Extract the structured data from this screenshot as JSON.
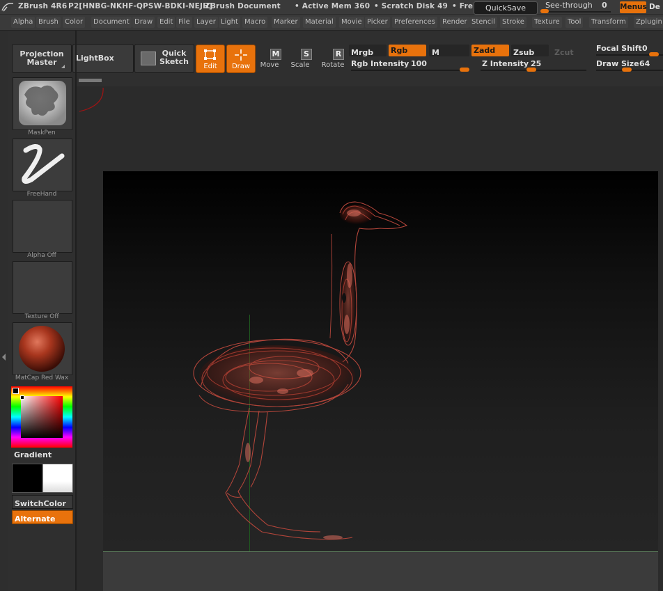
{
  "title_bar": {
    "app_name": "ZBrush 4R6",
    "serial": "P2[HNBG-NKHF-QPSW-BDKI-NEJH]",
    "document": "ZBrush Document",
    "active_mem": "• Active Mem 360",
    "scratch_disk": "• Scratch Disk 49",
    "free": "• Fre",
    "quicksave": "QuickSave",
    "see_through_label": "See-through",
    "see_through_value": "0",
    "see_through_level": 0,
    "menus": "Menus",
    "default_script": "De"
  },
  "menus": [
    "Alpha",
    "Brush",
    "Color",
    "Document",
    "Draw",
    "Edit",
    "File",
    "Layer",
    "Light",
    "Macro",
    "Marker",
    "Material",
    "Movie",
    "Picker",
    "Preferences",
    "Render",
    "Stencil",
    "Stroke",
    "Texture",
    "Tool",
    "Transform",
    "Zplugin"
  ],
  "shelf": {
    "projection_master_1": "Projection",
    "projection_master_2": "Master",
    "lightbox": "LightBox",
    "quick_sketch_1": "Quick",
    "quick_sketch_2": "Sketch",
    "edit": "Edit",
    "draw": "Draw",
    "move": "Move",
    "scale": "Scale",
    "rotate": "Rotate",
    "move_key": "M",
    "scale_key": "S",
    "rotate_key": "R",
    "mrgb": "Mrgb",
    "rgb": "Rgb",
    "m": "M",
    "zadd": "Zadd",
    "zsub": "Zsub",
    "zcut": "Zcut",
    "rgb_intensity_label": "Rgb Intensity",
    "rgb_intensity_value": "100",
    "z_intensity_label": "Z Intensity",
    "z_intensity_value": "25",
    "focal_shift_label": "Focal Shift",
    "focal_shift_value": "0",
    "draw_size_label": "Draw Size",
    "draw_size_value": "64"
  },
  "left_panel": {
    "brush": "MaskPen",
    "stroke": "FreeHand",
    "alpha": "Alpha Off",
    "texture": "Texture Off",
    "material": "MatCap Red Wax",
    "gradient": "Gradient",
    "switch_color": "SwitchColor",
    "alternate": "Alternate"
  },
  "colors": {
    "accent": "#e8720c",
    "material": "#8b2a1a",
    "model": "#a0392a",
    "primary_color": "#000000",
    "secondary_color": "#ffffff"
  }
}
